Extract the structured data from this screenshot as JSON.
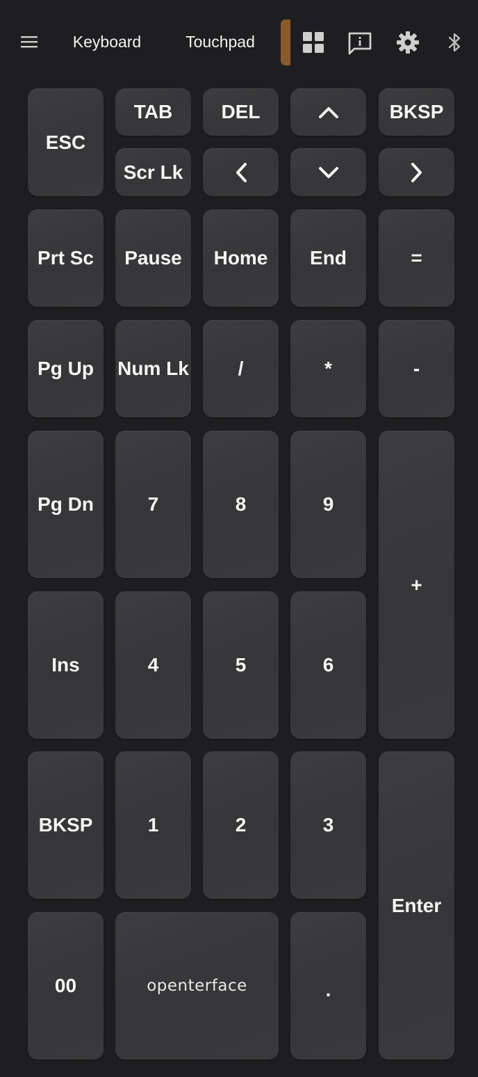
{
  "topbar": {
    "menu_icon": "hamburger-menu-icon",
    "tabs": [
      {
        "label": "Keyboard"
      },
      {
        "label": "Touchpad"
      }
    ],
    "icons": [
      "grid-icon",
      "info-icon",
      "gear-icon",
      "bluetooth-icon"
    ],
    "accent_color": "#8a5a2b"
  },
  "keys": {
    "esc": "ESC",
    "tab": "TAB",
    "del": "DEL",
    "bksp_top": "BKSP",
    "scrlk": "Scr Lk",
    "prtsc": "Prt Sc",
    "pause": "Pause",
    "home": "Home",
    "end": "End",
    "equals": "=",
    "pgup": "Pg Up",
    "numlk": "Num Lk",
    "slash": "/",
    "asterisk": "*",
    "minus": "-",
    "pgdn": "Pg Dn",
    "seven": "7",
    "eight": "8",
    "nine": "9",
    "plus": "+",
    "ins": "Ins",
    "four": "4",
    "five": "5",
    "six": "6",
    "bksp_bottom": "BKSP",
    "one": "1",
    "two": "2",
    "three": "3",
    "enter": "Enter",
    "doublezero": "00",
    "brand": "openterface",
    "dot": "."
  },
  "arrow_icons": [
    "chevron-up-icon",
    "chevron-left-icon",
    "chevron-down-icon",
    "chevron-right-icon"
  ],
  "colors": {
    "background": "#1e1e20",
    "key": "#3a3a3c",
    "key_text": "#f5f5f5"
  }
}
